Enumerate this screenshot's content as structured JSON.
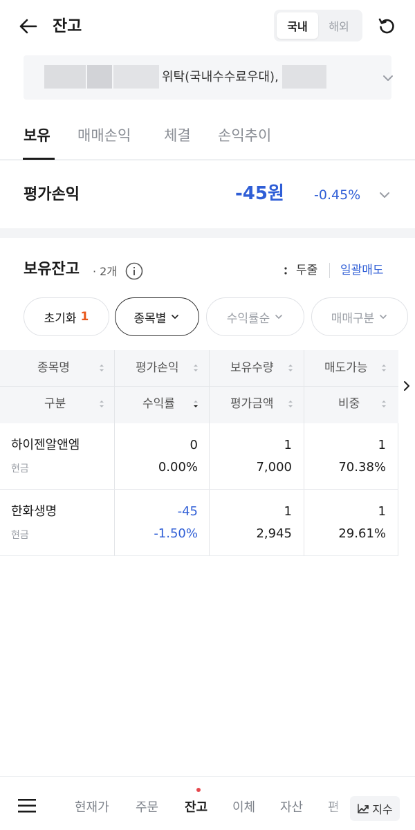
{
  "header": {
    "title": "잔고",
    "segments": [
      "국내",
      "해외"
    ],
    "active_segment": 0
  },
  "account": {
    "text": "위탁(국내수수료우대),"
  },
  "tabs": [
    {
      "label": "보유"
    },
    {
      "label": "매매손익"
    },
    {
      "label": "체결"
    },
    {
      "label": "손익추이"
    }
  ],
  "evaluation": {
    "label": "평가손익",
    "amount": "-45원",
    "rate": "-0.45%"
  },
  "holdings": {
    "title": "보유잔고",
    "count": "· 2개",
    "rows_label": "두줄",
    "sell_all_label": "일괄매도"
  },
  "chips": {
    "reset": {
      "label": "초기화",
      "count": "1"
    },
    "by_stock": "종목별",
    "sort_by_return": "수익률순",
    "trade_type": "매매구분"
  },
  "table": {
    "header_row1": [
      "종목명",
      "평가손익",
      "보유수량",
      "매도가능"
    ],
    "header_row2": [
      "구분",
      "수익률",
      "평가금액",
      "비중"
    ],
    "rows": [
      {
        "name": "하이젠알앤엠",
        "type": "현금",
        "pl": "0",
        "return": "0.00%",
        "qty": "1",
        "eval_amount": "7,000",
        "sellable": "1",
        "weight": "70.38%"
      },
      {
        "name": "한화생명",
        "type": "현금",
        "pl": "-45",
        "return": "-1.50%",
        "qty": "1",
        "eval_amount": "2,945",
        "sellable": "1",
        "weight": "29.61%"
      }
    ]
  },
  "bottom_nav": {
    "items": [
      "현재가",
      "주문",
      "잔고",
      "이체",
      "자산",
      "편"
    ],
    "active": 2,
    "index_label": "지수"
  },
  "colors": {
    "accent_blue": "#2f5ed6",
    "badge_orange": "#e8571b",
    "alert_dot": "#e5484d"
  }
}
